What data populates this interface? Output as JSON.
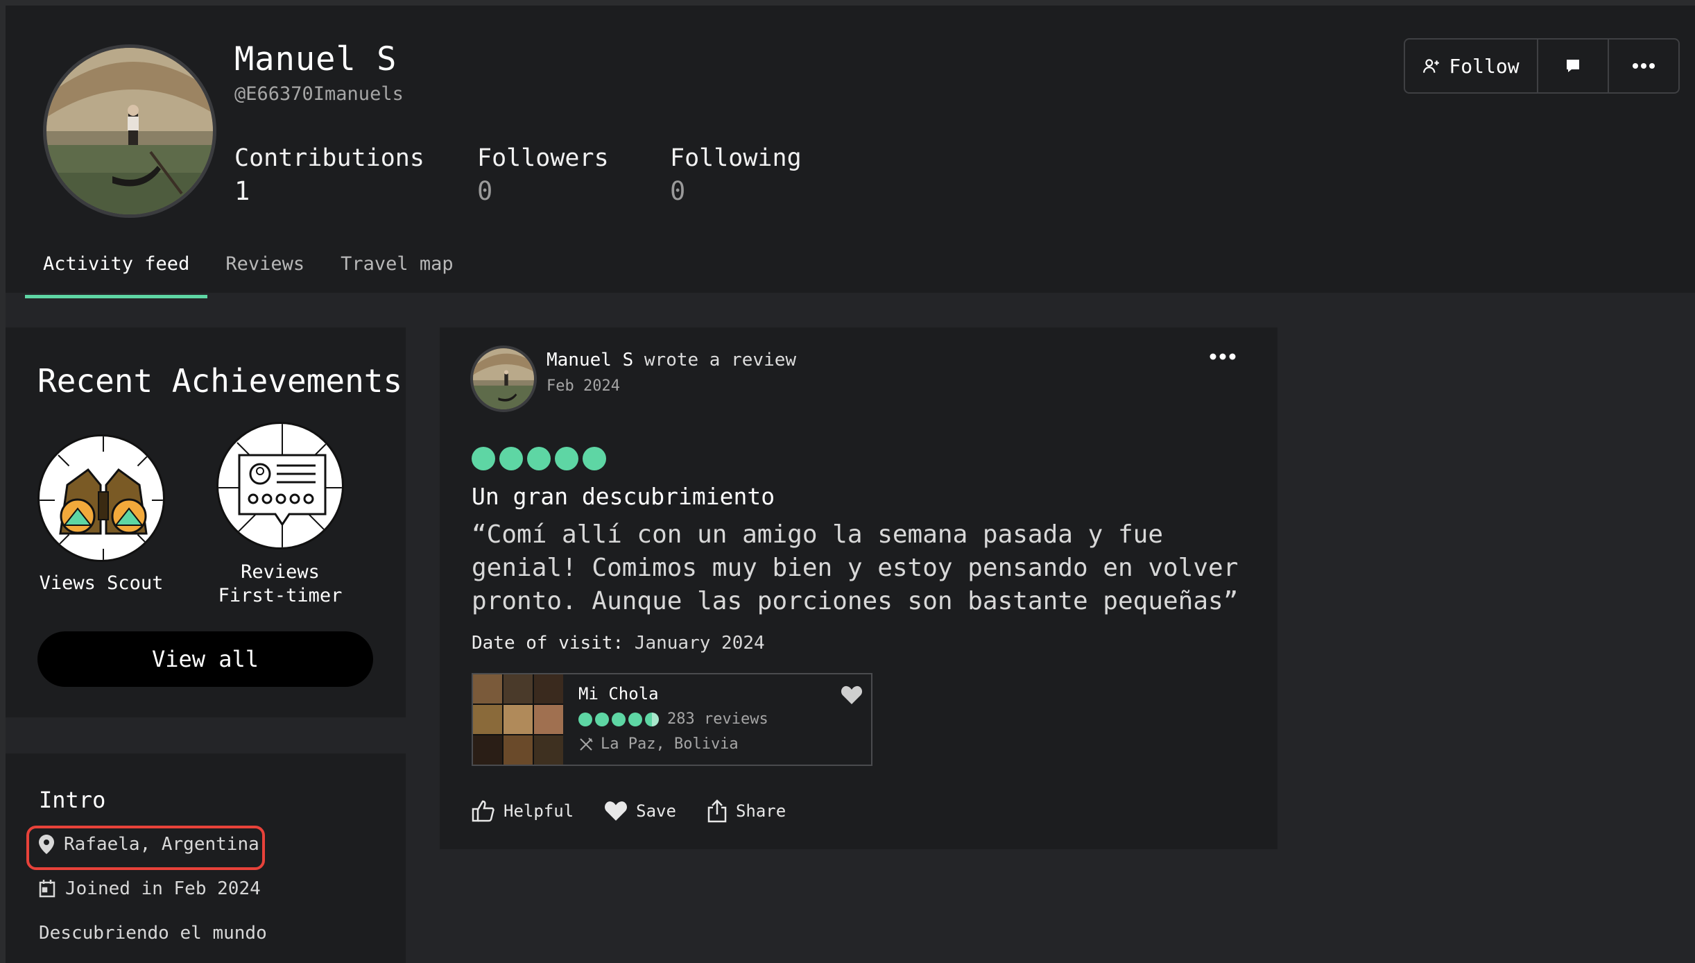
{
  "profile": {
    "name": "Manuel S",
    "handle": "@E66370Imanuels",
    "stats": [
      {
        "label": "Contributions",
        "value": "1"
      },
      {
        "label": "Followers",
        "value": "0"
      },
      {
        "label": "Following",
        "value": "0"
      }
    ]
  },
  "actions": {
    "follow_label": "Follow"
  },
  "tabs": [
    {
      "label": "Activity feed",
      "active": true
    },
    {
      "label": "Reviews",
      "active": false
    },
    {
      "label": "Travel map",
      "active": false
    }
  ],
  "achievements": {
    "title": "Recent Achievements",
    "badges": [
      {
        "label": "Views Scout",
        "icon": "binoculars-icon"
      },
      {
        "label": "Reviews First-timer",
        "icon": "review-card-icon"
      }
    ],
    "view_all_label": "View all"
  },
  "intro": {
    "title": "Intro",
    "location": "Rafaela, Argentina",
    "joined": "Joined in Feb 2024",
    "bio": "Descubriendo el mundo"
  },
  "post": {
    "author": "Manuel S",
    "action_text": "wrote a review",
    "date": "Feb 2024",
    "rating": 5,
    "review_title": "Un gran descubrimiento",
    "review_text": "“Comí allí con un amigo la semana pasada y fue genial! Comimos muy bien y estoy pensando en volver pronto. Aunque las porciones son bastante pequeñas”",
    "visit_label": "Date of visit:",
    "visit_value": "January 2024",
    "place": {
      "name": "Mi Chola",
      "rating": 4.5,
      "reviews": "283 reviews",
      "location": "La Paz, Bolivia"
    },
    "buttons": {
      "helpful": "Helpful",
      "save": "Save",
      "share": "Share"
    }
  },
  "colors": {
    "accent": "#5ed6a4",
    "highlight": "#e8423a",
    "background": "#242528",
    "card": "#1c1d1f"
  }
}
